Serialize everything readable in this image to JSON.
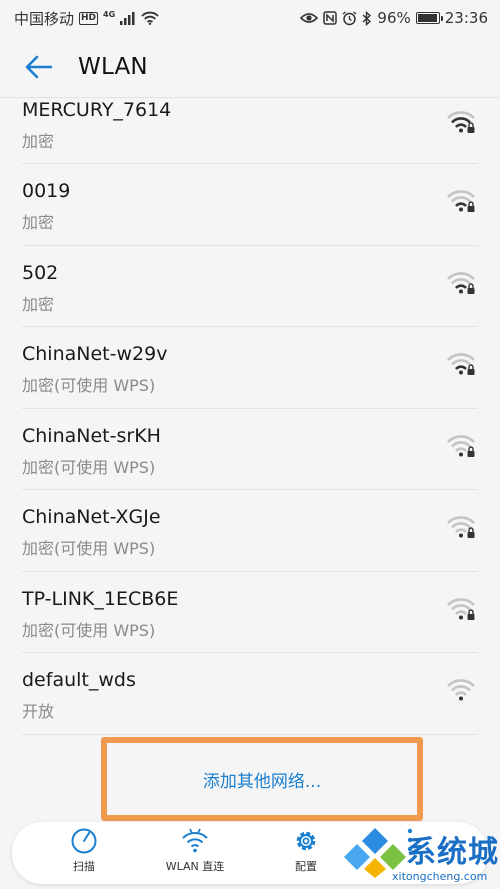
{
  "status_bar": {
    "carrier": "中国移动",
    "hd_badge": "HD",
    "network_type": "4G",
    "battery_percent": "96%",
    "time": "23:36"
  },
  "app_bar": {
    "title": "WLAN",
    "back_icon": "arrow-left-icon"
  },
  "networks": [
    {
      "ssid": "MERCURY_7614",
      "security": "加密",
      "locked": true
    },
    {
      "ssid": "0019",
      "security": "加密",
      "locked": true
    },
    {
      "ssid": "502",
      "security": "加密",
      "locked": true
    },
    {
      "ssid": "ChinaNet-w29v",
      "security": "加密(可使用 WPS)",
      "locked": true
    },
    {
      "ssid": "ChinaNet-srKH",
      "security": "加密(可使用 WPS)",
      "locked": true
    },
    {
      "ssid": "ChinaNet-XGJe",
      "security": "加密(可使用 WPS)",
      "locked": true
    },
    {
      "ssid": "TP-LINK_1ECB6E",
      "security": "加密(可使用 WPS)",
      "locked": true
    },
    {
      "ssid": "default_wds",
      "security": "开放",
      "locked": false
    }
  ],
  "add_network": {
    "label": "添加其他网络..."
  },
  "bottom_bar": {
    "scan": "扫描",
    "wlan_direct": "WLAN 直连",
    "config": "配置"
  },
  "watermark": {
    "brand": "系统城",
    "url": "xitongcheng.com"
  },
  "colors": {
    "accent": "#1b7fd0",
    "highlight_box": "#f09a50",
    "wifi_icon": "#c4c4c4"
  }
}
